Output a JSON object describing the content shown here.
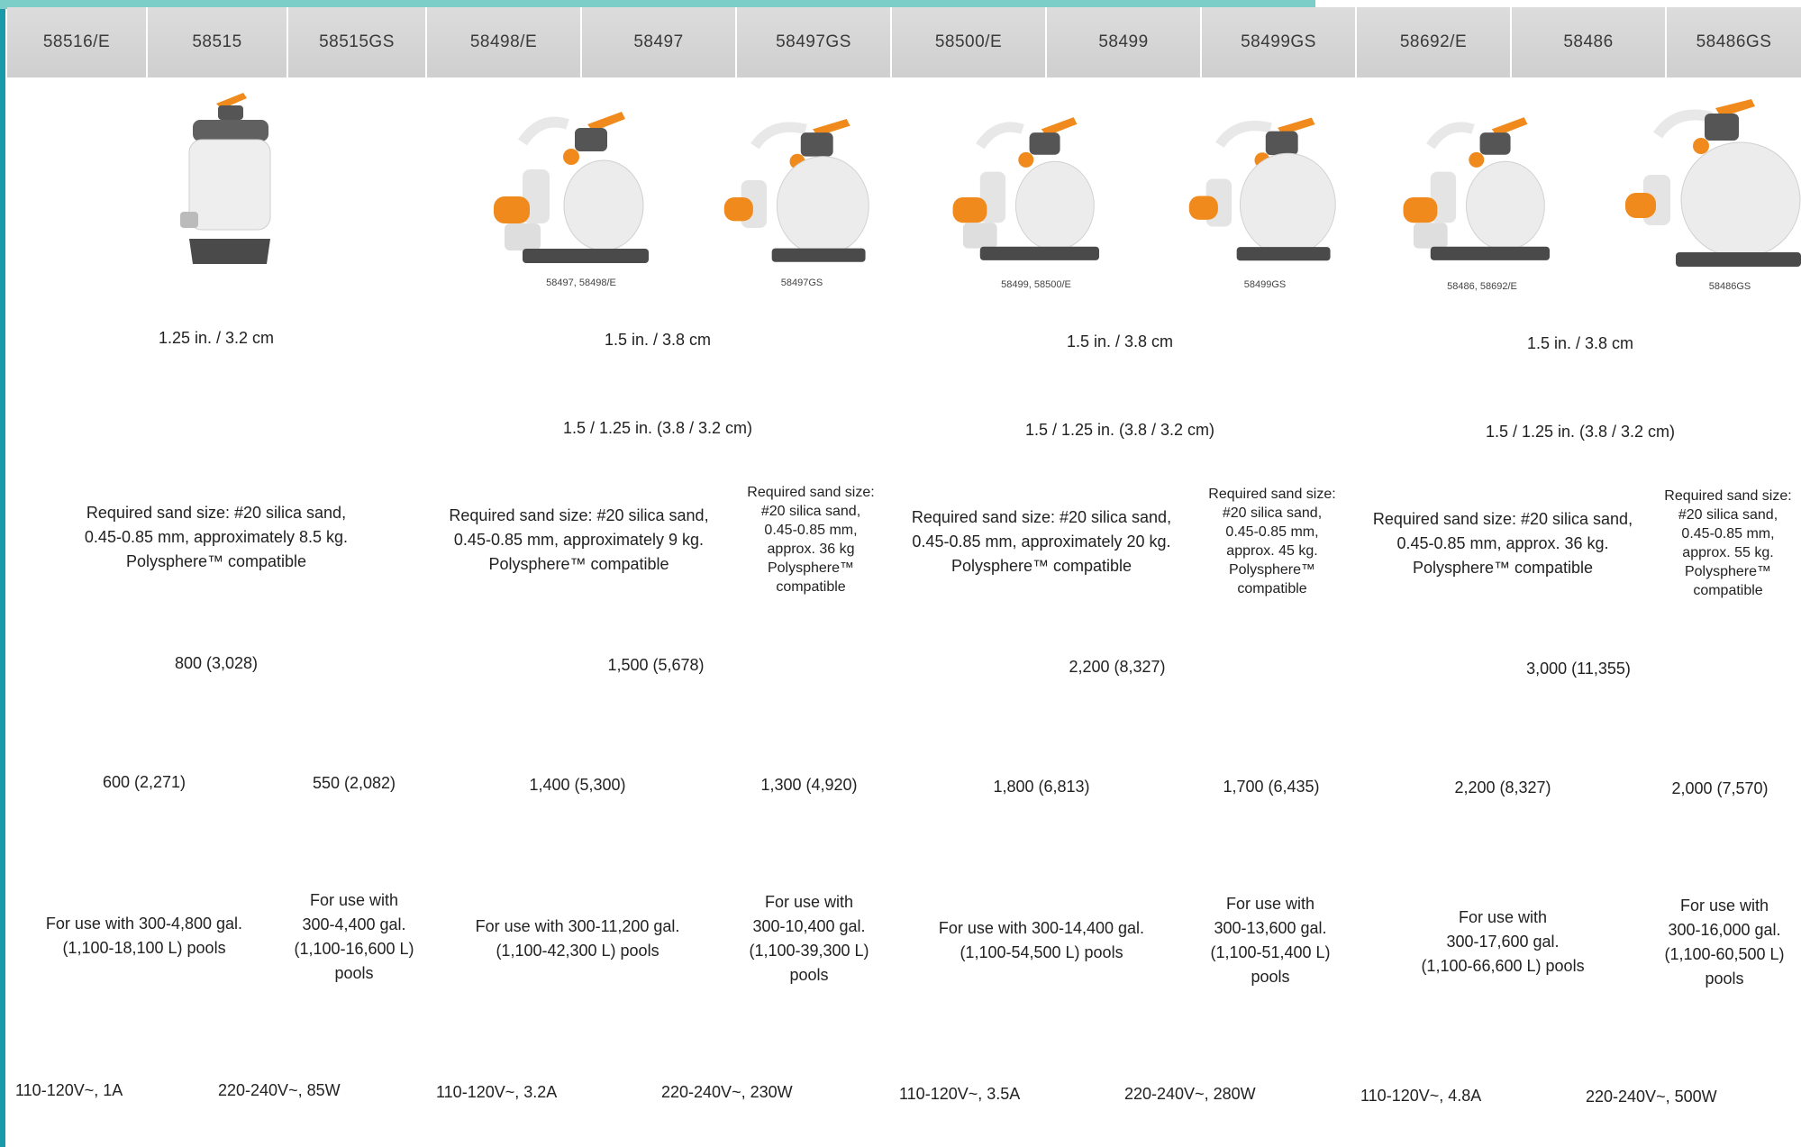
{
  "header": {
    "models": [
      "58516/E",
      "58515",
      "58515GS",
      "58498/E",
      "58497",
      "58497GS",
      "58500/E",
      "58499",
      "58499GS",
      "58692/E",
      "58486",
      "58486GS"
    ]
  },
  "products": {
    "captions": [
      "58497, 58498/E",
      "58497GS",
      "58499, 58500/E",
      "58499GS",
      "58486, 58692/E",
      "58486GS"
    ]
  },
  "rows": {
    "connection": [
      "1.25 in. / 3.2 cm",
      "1.5 in. / 3.8 cm",
      "1.5 in. / 3.8 cm",
      "1.5 in. / 3.8 cm"
    ],
    "hose": [
      "1.5 / 1.25 in. (3.8 / 3.2 cm)",
      "1.5 / 1.25 in. (3.8 / 3.2 cm)",
      "1.5 / 1.25 in. (3.8 / 3.2 cm)"
    ],
    "sand": [
      {
        "l1": "Required sand size: #20 silica sand,",
        "l2": "0.45-0.85 mm, approximately 8.5 kg.",
        "l3": "Polysphere™ compatible"
      },
      {
        "l1": "Required sand size: #20 silica sand,",
        "l2": "0.45-0.85 mm, approximately 9 kg.",
        "l3": "Polysphere™ compatible"
      },
      {
        "l1": "Required sand size:",
        "l2": "#20 silica sand,",
        "l3": "0.45-0.85 mm,",
        "l4": "approx. 36 kg",
        "l5": "Polysphere™",
        "l6": "compatible"
      },
      {
        "l1": "Required sand size: #20 silica sand,",
        "l2": "0.45-0.85 mm, approximately 20 kg.",
        "l3": "Polysphere™ compatible"
      },
      {
        "l1": "Required sand size:",
        "l2": "#20 silica sand,",
        "l3": "0.45-0.85 mm,",
        "l4": "approx. 45 kg.",
        "l5": "Polysphere™",
        "l6": "compatible"
      },
      {
        "l1": "Required sand size: #20 silica sand,",
        "l2": "0.45-0.85 mm, approx. 36 kg.",
        "l3": "Polysphere™ compatible"
      },
      {
        "l1": "Required sand size:",
        "l2": "#20 silica sand,",
        "l3": "0.45-0.85 mm,",
        "l4": "approx. 55 kg.",
        "l5": "Polysphere™",
        "l6": "compatible"
      }
    ],
    "flow_rate": [
      "800 (3,028)",
      "1,500 (5,678)",
      "2,200 (8,327)",
      "3,000 (11,355)"
    ],
    "pump_flow": [
      "600 (2,271)",
      "550 (2,082)",
      "1,400 (5,300)",
      "1,300 (4,920)",
      "1,800 (6,813)",
      "1,700 (6,435)",
      "2,200 (8,327)",
      "2,000 (7,570)"
    ],
    "pool_size": [
      {
        "l1": "For use with 300-4,800 gal.",
        "l2": "(1,100-18,100 L) pools"
      },
      {
        "l1": "For use with",
        "l2": "300-4,400 gal.",
        "l3": "(1,100-16,600 L)",
        "l4": "pools"
      },
      {
        "l1": "For use with 300-11,200 gal.",
        "l2": "(1,100-42,300 L) pools"
      },
      {
        "l1": "For use with",
        "l2": "300-10,400 gal.",
        "l3": "(1,100-39,300 L)",
        "l4": "pools"
      },
      {
        "l1": "For use with 300-14,400 gal.",
        "l2": "(1,100-54,500 L) pools"
      },
      {
        "l1": "For use with",
        "l2": "300-13,600 gal.",
        "l3": "(1,100-51,400 L)",
        "l4": "pools"
      },
      {
        "l1": "For use with",
        "l2": "300-17,600 gal.",
        "l3": "(1,100-66,600 L) pools"
      },
      {
        "l1": "For use with",
        "l2": "300-16,000 gal.",
        "l3": "(1,100-60,500 L)",
        "l4": "pools"
      }
    ],
    "voltage": [
      "110-120V~, 1A",
      "220-240V~, 85W",
      "110-120V~, 3.2A",
      "220-240V~, 230W",
      "110-120V~, 3.5A",
      "220-240V~, 280W",
      "110-120V~, 4.8A",
      "220-240V~, 500W"
    ]
  },
  "colors": {
    "accent": "#f08a1c",
    "teal": "#1a9aa8",
    "header_bg": "#d4d4d4",
    "tank": "#eeeeee",
    "base": "#4a4a4a"
  }
}
